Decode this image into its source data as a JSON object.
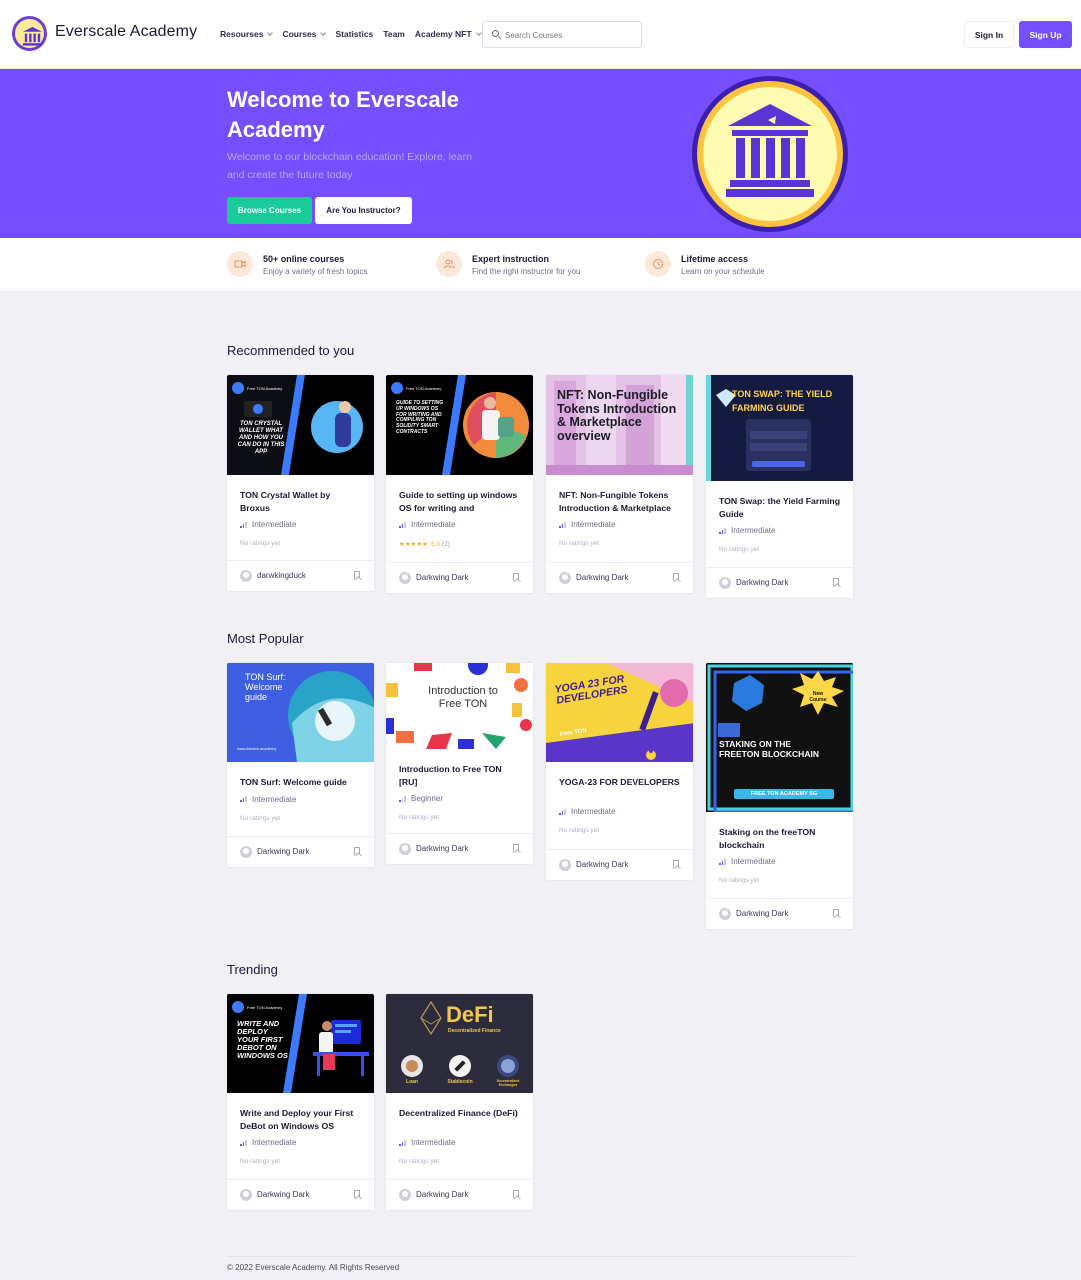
{
  "header": {
    "brand": "Everscale Academy",
    "nav": [
      {
        "label": "Resourses",
        "dropdown": true
      },
      {
        "label": "Courses",
        "dropdown": true
      },
      {
        "label": "Statistics",
        "dropdown": false
      },
      {
        "label": "Team",
        "dropdown": false
      },
      {
        "label": "Academy NFT",
        "dropdown": true
      }
    ],
    "search_placeholder": "Search Courses",
    "sign_in": "Sign In",
    "sign_up": "Sign Up"
  },
  "hero": {
    "title": "Welcome to Everscale Academy",
    "subtitle": "Welcome to our blockchain education! Explore, learn and create the future today",
    "browse_button": "Browse Courses",
    "instructor_button": "Are You Instructor?"
  },
  "features": [
    {
      "title": "50+ online courses",
      "subtitle": "Enjoy a variety of fresh topics",
      "icon": "video-icon"
    },
    {
      "title": "Expert instruction",
      "subtitle": "Find the right instructor for you",
      "icon": "users-icon"
    },
    {
      "title": "Lifetime access",
      "subtitle": "Learn on your schedule",
      "icon": "clock-icon"
    }
  ],
  "sections": [
    {
      "title": "Recommended to you",
      "courses": [
        {
          "title": "TON Crystal Wallet by Broxus",
          "level": "Intermediate",
          "rating": "No ratings yet",
          "author": "darwkingduck",
          "thumb_text": "TON CRYSTAL WALLET WHAT AND HOW YOU CAN DO IN THIS APP",
          "thumb_brand": "Free TON Academy"
        },
        {
          "title": "Guide to setting up windows OS for writing and",
          "level": "Intermediate",
          "rating_stars": "★★★★★",
          "rating_value": "5.0",
          "rating_count": "(2)",
          "author": "Darkwing Dark",
          "thumb_text": "GUIDE TO SETTING UP WINDOWS OS FOR WRITING AND COMPILING TON SOLIDITY SMART CONTRACTS",
          "thumb_brand": "Free TON Academy"
        },
        {
          "title": "NFT: Non-Fungible Tokens Introduction & Marketplace",
          "level": "Intermediate",
          "rating": "No ratings yet",
          "author": "Darkwing Dark",
          "thumb_text": "NFT: Non-Fungible Tokens Introduction & Marketplace overview"
        },
        {
          "title": "TON Swap: the Yield Farming Guide",
          "level": "Intermediate",
          "rating": "No ratings yet",
          "author": "Darkwing Dark",
          "thumb_text": "TON SWAP: THE YIELD FARMING GUIDE"
        }
      ]
    },
    {
      "title": "Most Popular",
      "courses": [
        {
          "title": "TON Surf: Welcome guide",
          "level": "Intermediate",
          "rating": "No ratings yet",
          "author": "Darkwing Dark",
          "thumb_text": "TON Surf: Welcome guide",
          "thumb_url": "www.freeton.academy"
        },
        {
          "title": "Introduction to Free TON [RU]",
          "level": "Beginner",
          "rating": "No ratings yet",
          "author": "Darkwing Dark",
          "thumb_text": "Introduction to Free TON"
        },
        {
          "title": "YOGA-23 FOR DEVELOPERS",
          "level": "Intermediate",
          "rating": "No ratings yet",
          "author": "Darkwing Dark",
          "thumb_text": "YOGA 23 FOR DEVELOPERS",
          "thumb_sub": "Free TON"
        },
        {
          "title": "Staking on the freeTON blockchain",
          "level": "Intermediate",
          "rating": "No ratings yet",
          "author": "Darkwing Dark",
          "thumb_text": "STAKING ON THE FREETON BLOCKCHAIN",
          "thumb_badge": "New Course",
          "thumb_footer": "FREE TON ACADEMY SG"
        }
      ]
    },
    {
      "title": "Trending",
      "courses": [
        {
          "title": "Write and Deploy your First DeBot on Windows OS",
          "level": "Intermediate",
          "rating": "No ratings yet",
          "author": "Darkwing Dark",
          "thumb_text": "WRITE AND DEPLOY YOUR FIRST DEBOT ON WINDOWS OS",
          "thumb_brand": "Free TON Academy"
        },
        {
          "title": "Decentralized Finance (DeFi)",
          "level": "Intermediate",
          "rating": "No ratings yet",
          "author": "Darkwing Dark",
          "thumb_text": "DeFi",
          "thumb_sub": "Decentralized Finance",
          "thumb_items": [
            "Loan",
            "Stablecoin",
            "Decentralized Exchanges"
          ]
        }
      ]
    }
  ],
  "footer": {
    "copyright": "© 2022 Everscale Academy. All Rights Reserved"
  },
  "colors": {
    "primary": "#754ffe",
    "success": "#19cb98",
    "background": "#f1f1f5"
  }
}
